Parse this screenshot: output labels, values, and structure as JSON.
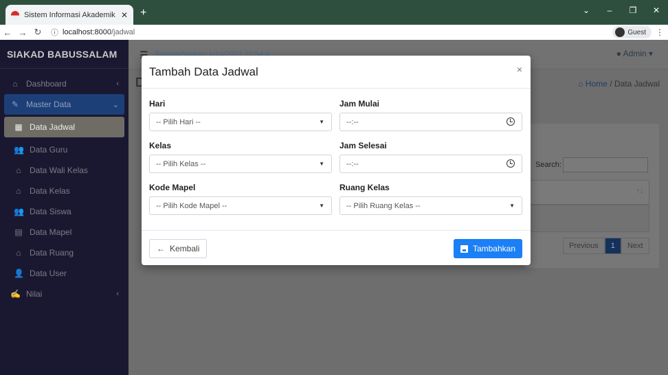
{
  "browser": {
    "tab_title": "Sistem Informasi Akademik Pond",
    "url_host": "localhost:8000",
    "url_path": "/jadwal",
    "profile": "Guest"
  },
  "sidebar": {
    "brand": "SIAKAD BABUSSALAM",
    "items": [
      {
        "label": "Dashboard",
        "icon": "home-icon"
      },
      {
        "label": "Master Data",
        "icon": "edit-icon"
      },
      {
        "label": "Data Jadwal",
        "icon": "calendar-icon"
      },
      {
        "label": "Data Guru",
        "icon": "users-icon"
      },
      {
        "label": "Data Wali Kelas",
        "icon": "home-icon"
      },
      {
        "label": "Data Kelas",
        "icon": "home-icon"
      },
      {
        "label": "Data Siswa",
        "icon": "users-icon"
      },
      {
        "label": "Data Mapel",
        "icon": "book-icon"
      },
      {
        "label": "Data Ruang",
        "icon": "home-icon"
      },
      {
        "label": "Data User",
        "icon": "user-plus-icon"
      },
      {
        "label": "Nilai",
        "icon": "signature-icon"
      }
    ]
  },
  "topbar": {
    "time_info": "Tanggal/Waktu: 1/10/2022 10:54:4",
    "admin": "Admin"
  },
  "breadcrumb": {
    "home": "Home",
    "current": "Data Jadwal"
  },
  "table": {
    "search_label": "Search:",
    "prev": "Previous",
    "page": "1",
    "next": "Next"
  },
  "modal": {
    "title": "Tambah Data Jadwal",
    "fields": {
      "hari": {
        "label": "Hari",
        "placeholder": "-- Pilih Hari --"
      },
      "jam_mulai": {
        "label": "Jam Mulai",
        "value": "--:--"
      },
      "kelas": {
        "label": "Kelas",
        "placeholder": "-- Pilih Kelas --"
      },
      "jam_selesai": {
        "label": "Jam Selesai",
        "value": "--:--"
      },
      "kode_mapel": {
        "label": "Kode Mapel",
        "placeholder": "-- Pilih Kode Mapel --"
      },
      "ruang_kelas": {
        "label": "Ruang Kelas",
        "placeholder": "-- Pilih Ruang Kelas --"
      }
    },
    "back_label": "Kembali",
    "submit_label": "Tambahkan"
  },
  "colors": {
    "primary": "#1b7ff5",
    "sidebar": "#1a1830",
    "chrome": "#2f4f3e"
  }
}
